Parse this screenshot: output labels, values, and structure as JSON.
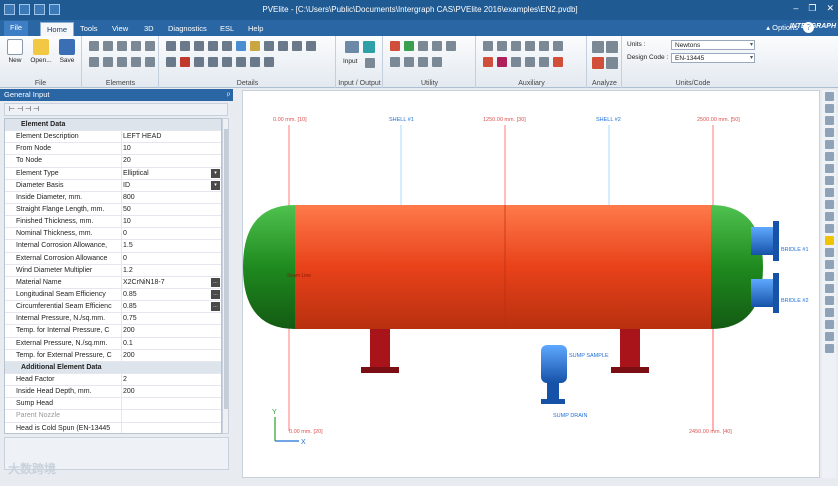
{
  "window": {
    "title": "PVElite - [C:\\Users\\Public\\Documents\\Intergraph CAS\\PVElite 2016\\examples\\EN2.pvdb]",
    "controls": [
      "–",
      "❐",
      "✕"
    ]
  },
  "menu_tabs": [
    "File",
    "Home",
    "Tools",
    "View",
    "3D",
    "Diagnostics",
    "ESL",
    "Help"
  ],
  "active_tab": "Home",
  "options_label": "Options",
  "help_symbol": "?",
  "brand": "INTERGRAPH",
  "ribbon": {
    "file_group": {
      "label": "File",
      "buttons": [
        "New",
        "Open...",
        "Save"
      ]
    },
    "elements_group": {
      "label": "Elements"
    },
    "details_group": {
      "label": "Details"
    },
    "io_group": {
      "label": "Input / Output",
      "input_button": "Input"
    },
    "utility_group": {
      "label": "Utility"
    },
    "auxiliary_group": {
      "label": "Auxiliary"
    },
    "analyze_group": {
      "label": "Analyze"
    },
    "units_group": {
      "label": "Units/Code",
      "units_label": "Units :",
      "units_value": "Newtons",
      "code_label": "Design Code :",
      "code_value": "EN-13445"
    }
  },
  "panel": {
    "title": "General Input",
    "pin": "ᵖ",
    "tools": "⊢ ⊣ ⊣ ⊣",
    "rows": [
      {
        "label": "Element Data",
        "value": "",
        "section": true
      },
      {
        "label": "Element Description",
        "value": "LEFT HEAD"
      },
      {
        "label": "From Node",
        "value": "10"
      },
      {
        "label": "To Node",
        "value": "20"
      },
      {
        "label": "Element Type",
        "value": "Elliptical",
        "dropdown": true
      },
      {
        "label": "Diameter Basis",
        "value": "ID",
        "dropdown": true
      },
      {
        "label": "Inside Diameter, mm.",
        "value": "800"
      },
      {
        "label": "Straight Flange Length, mm.",
        "value": "50"
      },
      {
        "label": "Finished Thickness, mm.",
        "value": "10"
      },
      {
        "label": "Nominal Thickness, mm.",
        "value": "0"
      },
      {
        "label": "Internal Corrosion Allowance,",
        "value": "1.5"
      },
      {
        "label": "External Corrosion Allowance",
        "value": "0"
      },
      {
        "label": "Wind Diameter Multiplier",
        "value": "1.2"
      },
      {
        "label": "Material Name",
        "value": "X2CrNiN18-7",
        "browse": true
      },
      {
        "label": "Longitudinal Seam Efficiency",
        "value": "0.85",
        "browse": true
      },
      {
        "label": "Circumferential Seam Efficienc",
        "value": "0.85",
        "browse": true
      },
      {
        "label": "Internal Pressure, N./sq.mm.",
        "value": "0.75"
      },
      {
        "label": "Temp. for Internal Pressure, C",
        "value": "200"
      },
      {
        "label": "External Pressure, N./sq.mm.",
        "value": "0.1"
      },
      {
        "label": "Temp. for External Pressure, C",
        "value": "200"
      },
      {
        "label": "Additional Element Data",
        "value": "",
        "section": true
      },
      {
        "label": "Head Factor",
        "value": "2"
      },
      {
        "label": "Inside Head Depth, mm.",
        "value": "200"
      },
      {
        "label": "Sump Head",
        "value": ""
      },
      {
        "label": "Parent Nozzle",
        "value": "",
        "dim": true
      },
      {
        "label": "Head is Cold Spun (EN-13445",
        "value": ""
      }
    ]
  },
  "drawing": {
    "top_labels": [
      "0.00 mm. [10]",
      "SHELL #1",
      "1250.00 mm. [30]",
      "SHELL #2",
      "2500.00 mm. [50]"
    ],
    "bottom_labels": [
      "0.00 mm. [20]",
      "2450.00 mm. [40]"
    ],
    "nozzle_labels": [
      "BRIDLE #1",
      "BRIDLE #2"
    ],
    "sump_labels": [
      "SUMP SAMPLE",
      "SUMP DRAIN"
    ],
    "seam_label": "Seam Line",
    "axis_labels": [
      "Y",
      "X"
    ],
    "colors": {
      "shell": "#e8421a",
      "head": "#1f8a1f",
      "saddle": "#a8141a",
      "nozzle": "#1f6fd6",
      "dim_line_red": "#ff5a5a",
      "dim_line_blue": "#8fd3ff"
    }
  },
  "watermark": "大数跨境"
}
